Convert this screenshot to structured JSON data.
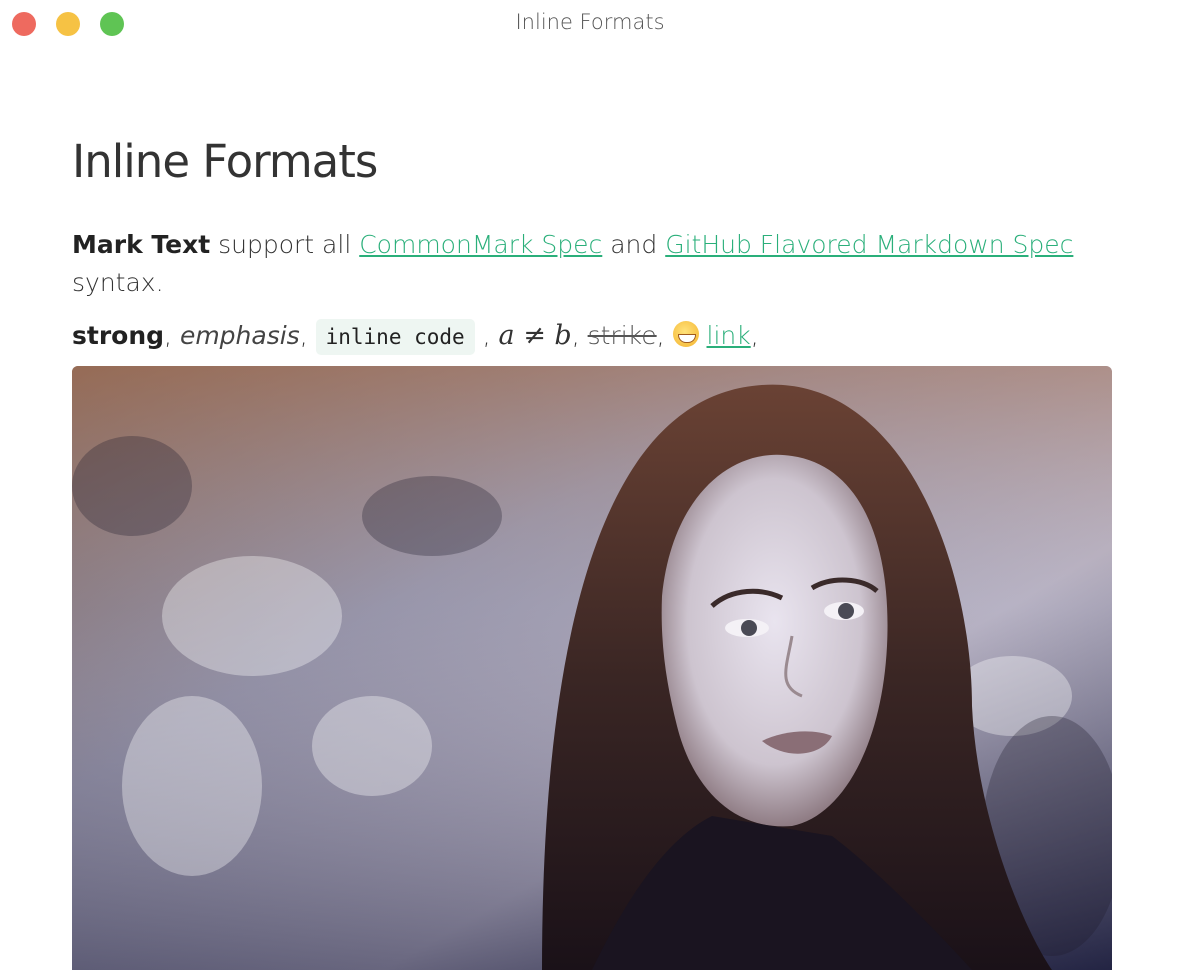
{
  "window": {
    "title": "Inline Formats"
  },
  "document": {
    "heading": "Inline Formats",
    "intro": {
      "strong": "Mark Text",
      "text1": " support all ",
      "link1": "CommonMark Spec",
      "text2": " and ",
      "link2": "GitHub Flavored Markdown Spec",
      "text3": " syntax."
    },
    "formats": {
      "strong": "strong",
      "sep1": ", ",
      "emphasis": "emphasis",
      "sep2": ", ",
      "code": "inline code",
      "sep3": " , ",
      "math": "a ≠ b",
      "sep4": ", ",
      "strike": "strike",
      "sep5": ", ",
      "emoji_name": "grinning-face-emoji",
      "link": "link",
      "sep6": ","
    },
    "image": {
      "description_icon": "portrait-photo"
    }
  },
  "colors": {
    "link": "#2aaf7a",
    "code_bg": "#eef6f2",
    "close": "#ee6a5f",
    "minimize": "#f6c244",
    "maximize": "#5fc454"
  }
}
